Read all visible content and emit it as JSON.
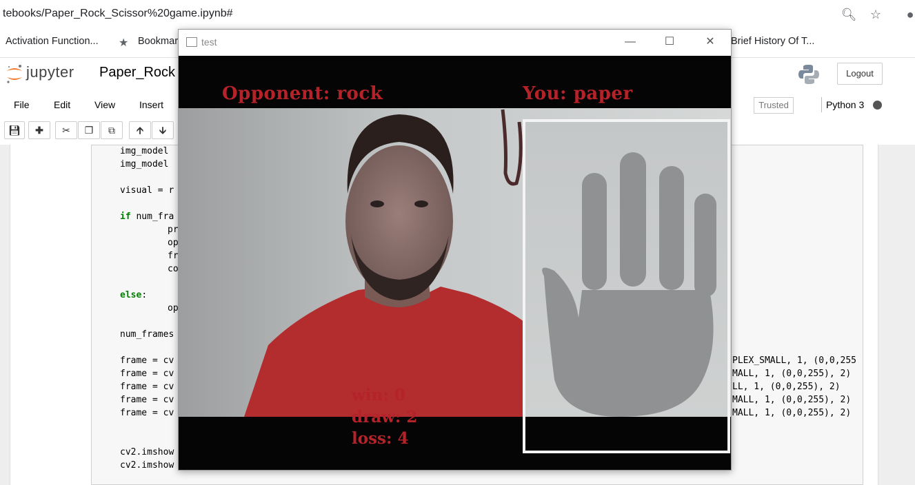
{
  "browser": {
    "url": "tebooks/Paper_Rock_Scissor%20game.ipynb#",
    "bookmarks": [
      "Activation Function...",
      "Bookmar",
      "Brief History Of T..."
    ]
  },
  "jupyter": {
    "logo_text": "jupyter",
    "notebook_name": "Paper_Rock",
    "logout_label": "Logout",
    "menu": [
      "File",
      "Edit",
      "View",
      "Insert"
    ],
    "trusted_label": "Trusted",
    "kernel_name": "Python 3"
  },
  "code_lines": {
    "l1": "img_model",
    "l2": "img_model",
    "l3": "visual = r",
    "l4_kw": "if",
    "l4_rest": " num_fra",
    "l5": "pr",
    "l6": "op",
    "l7": "fr",
    "l8": "co",
    "l9_kw": "else",
    "l9_rest": ":",
    "l10": "op",
    "l11": "num_frames",
    "f1": "frame = cv",
    "f2": "frame = cv",
    "f3": "frame = cv",
    "f4": "frame = cv",
    "f5": "frame = cv",
    "r1": "PLEX_SMALL, 1, (0,0,255",
    "r2": "MALL, 1, (0,0,255), 2)",
    "r3": "LL, 1, (0,0,255), 2)",
    "r4": "MALL, 1, (0,0,255), 2)",
    "r5": "MALL, 1, (0,0,255), 2)",
    "s1": "cv2.imshow",
    "s2": "cv2.imshow"
  },
  "cv_window": {
    "title": "test",
    "opponent_text": "Opponent: rock",
    "you_text": "You: paper",
    "win_text": "win: 0",
    "draw_text": "draw: 2",
    "loss_text": "loss: 4"
  },
  "colors": {
    "hud_text": "#b5232a",
    "shirt": "#b32c2e",
    "wall": "#c8cbcc"
  }
}
